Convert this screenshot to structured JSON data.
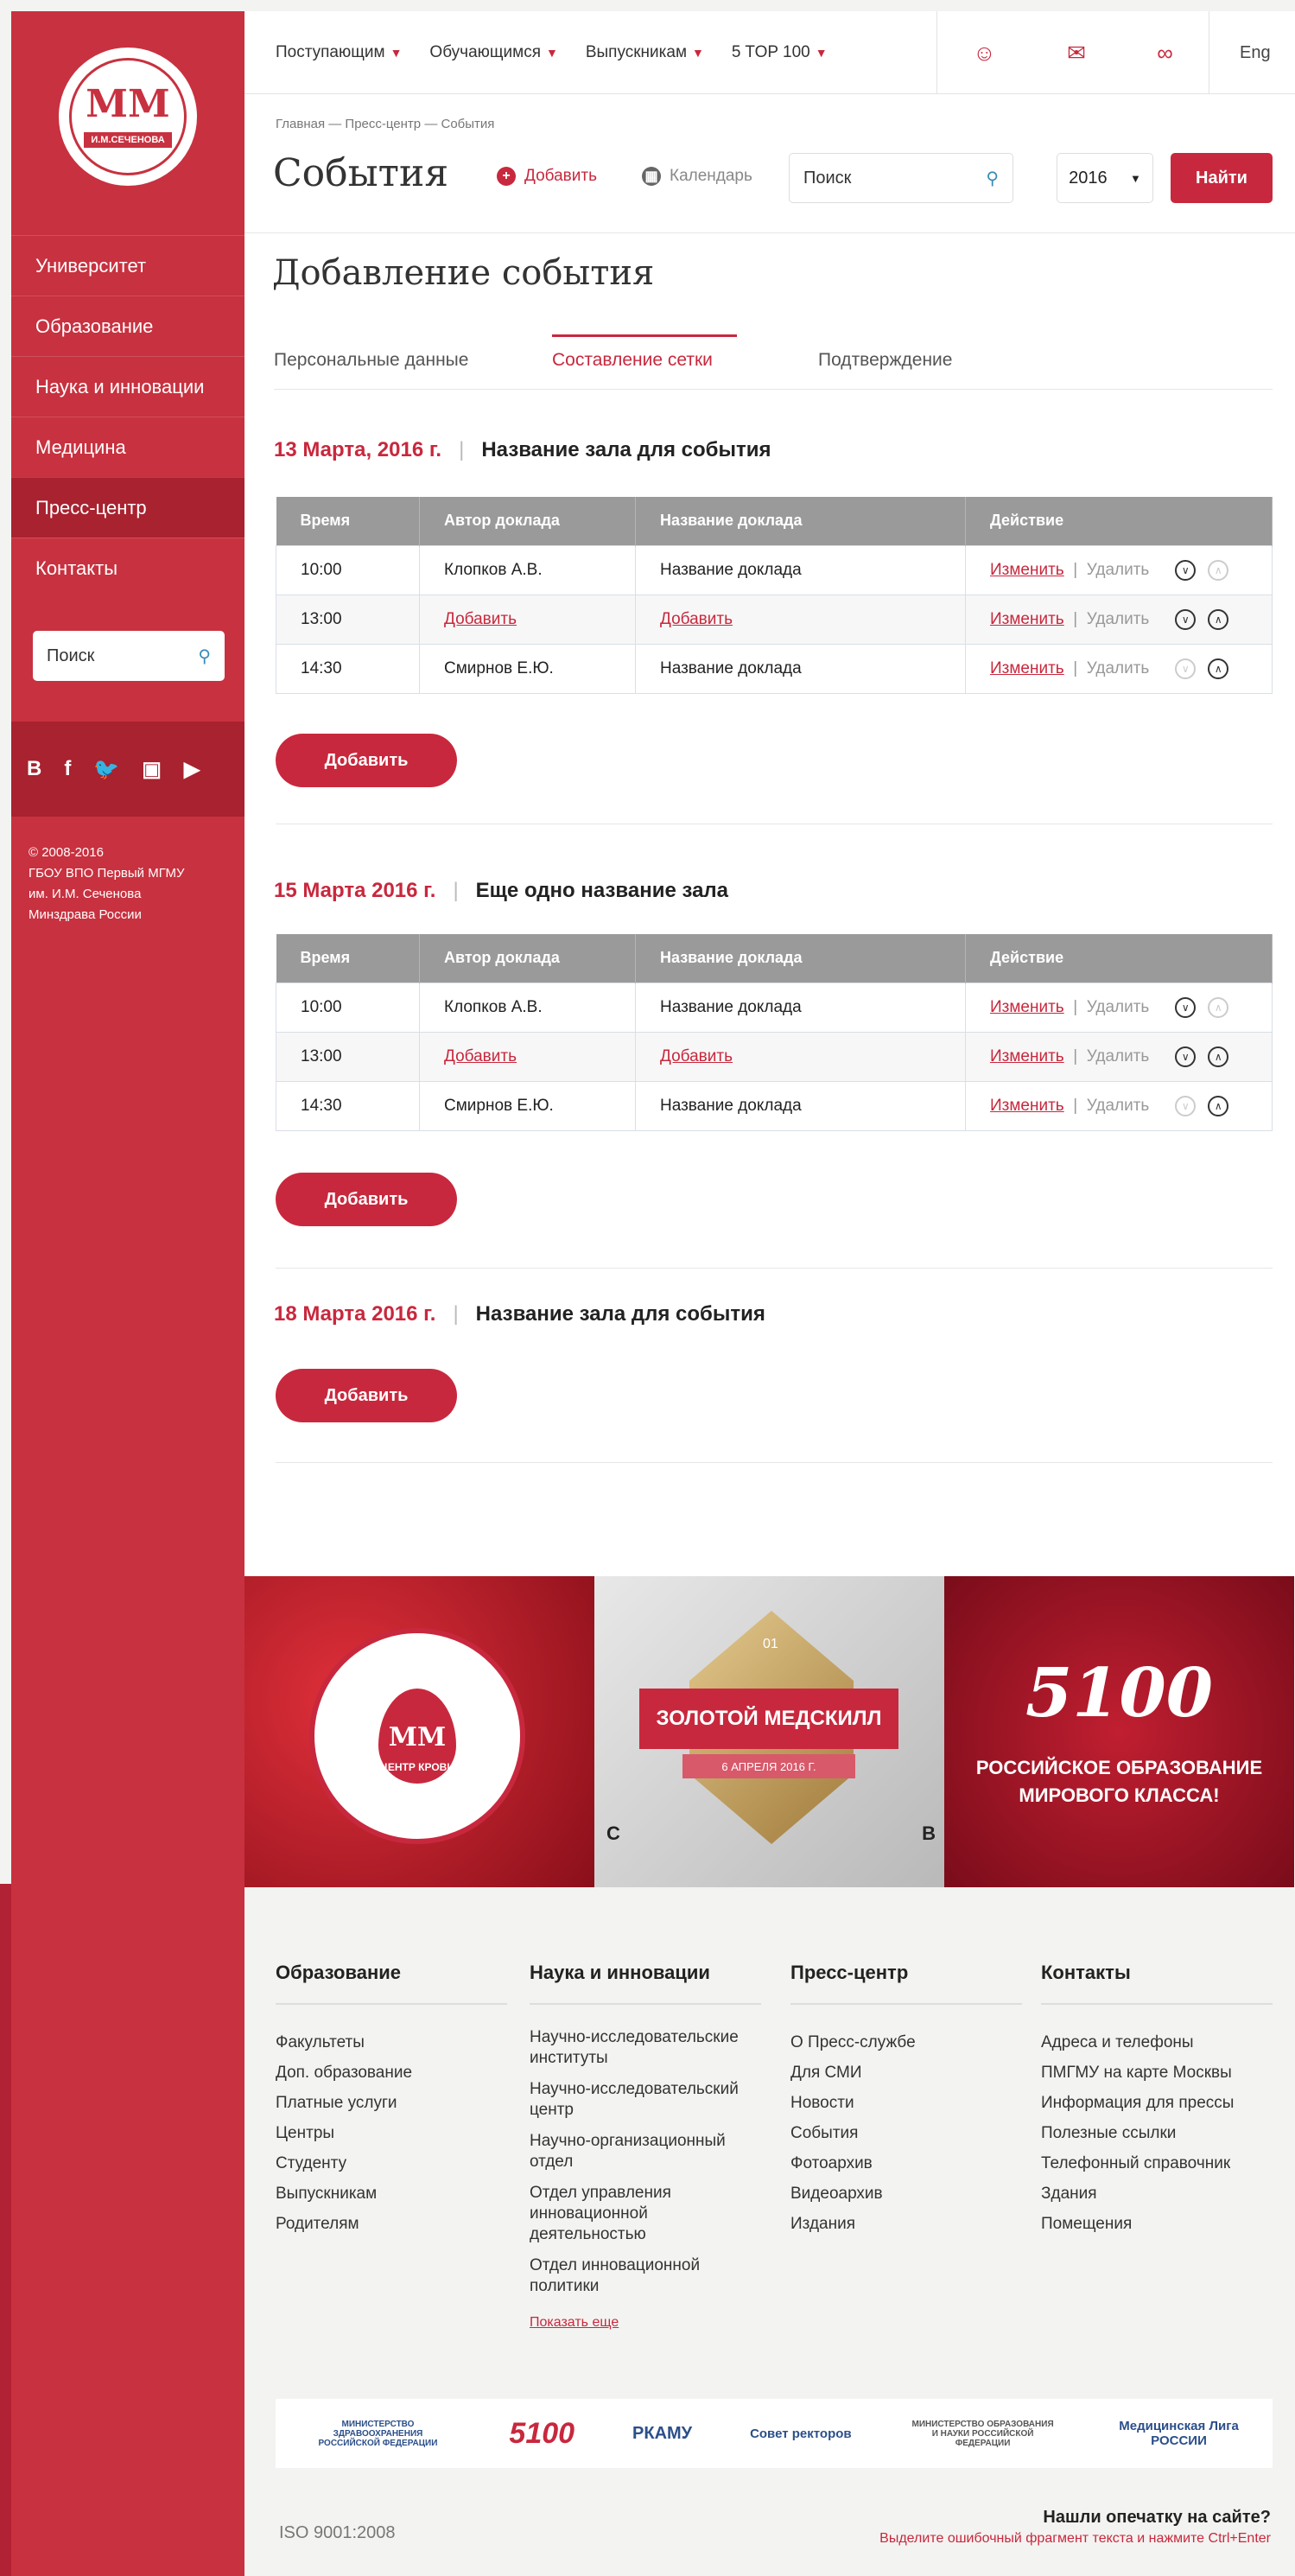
{
  "sidebar": {
    "logo_mark": "ММ",
    "logo_text": "И.М.СЕЧЕНОВА",
    "items": [
      {
        "label": "Университет"
      },
      {
        "label": "Образование"
      },
      {
        "label": "Наука и инновации"
      },
      {
        "label": "Медицина"
      },
      {
        "label": "Пресс-центр",
        "active": true
      },
      {
        "label": "Контакты"
      }
    ],
    "search_placeholder": "Поиск",
    "social": [
      "B",
      "f",
      "t",
      "ig",
      "yt"
    ],
    "copyright": [
      "© 2008-2016",
      "ГБОУ ВПО Первый МГМУ",
      "им. И.М. Сеченова",
      "Минздрава России"
    ]
  },
  "topbar": {
    "nav": [
      "Поступающим",
      "Обучающимся",
      "Выпускникам",
      "5 TOP 100"
    ],
    "icons": [
      "user-icon",
      "mail-icon",
      "glasses-icon"
    ],
    "lang": "Eng"
  },
  "main": {
    "breadcrumb": "Главная — Пресс-центр — События",
    "title": "События",
    "add_label": "Добавить",
    "calendar_label": "Календарь",
    "search_placeholder": "Поиск",
    "year": "2016",
    "find_label": "Найти",
    "subtitle": "Добавление события",
    "steps": [
      "Персональные данные",
      "Составление сетки",
      "Подтверждение"
    ],
    "table_headers": [
      "Время",
      "Автор доклада",
      "Название доклада",
      "Действие"
    ],
    "edit_label": "Изменить",
    "delete_label": "Удалить",
    "add_button": "Добавить",
    "halls": [
      {
        "date": "13 Марта, 2016 г.",
        "name": "Название зала для события",
        "rows": [
          {
            "time": "10:00",
            "author": "Клопков А.В.",
            "title": "Название доклада"
          },
          {
            "time": "13:00",
            "author": "Добавить",
            "title": "Добавить"
          },
          {
            "time": "14:30",
            "author": "Смирнов Е.Ю.",
            "title": "Название доклада"
          }
        ]
      },
      {
        "date": "15 Марта 2016 г.",
        "name": "Еще одно название зала",
        "rows": [
          {
            "time": "10:00",
            "author": "Клопков А.В.",
            "title": "Название доклада"
          },
          {
            "time": "13:00",
            "author": "Добавить",
            "title": "Добавить"
          },
          {
            "time": "14:30",
            "author": "Смирнов Е.Ю.",
            "title": "Название доклада"
          }
        ]
      },
      {
        "date": "18 Марта 2016 г.",
        "name": "Название зала для события",
        "rows": []
      }
    ]
  },
  "banners": {
    "blood": {
      "mark": "ММ",
      "label": "ЦЕНТР КРОВИ"
    },
    "medskill": {
      "num": "01",
      "title": "ЗОЛОТОЙ МЕДСКИЛЛ",
      "date": "6 АПРЕЛЯ 2016 Г.",
      "left": "C",
      "right": "B"
    },
    "top100": {
      "logo": "5100",
      "text": [
        "РОССИЙСКОЕ ОБРАЗОВАНИЕ",
        "МИРОВОГО КЛАССА!"
      ]
    }
  },
  "footer": {
    "columns": [
      {
        "title": "Образование",
        "items": [
          "Факультеты",
          "Доп. образование",
          "Платные услуги",
          "Центры",
          "Студенту",
          "Выпускникам",
          "Родителям"
        ]
      },
      {
        "title": "Наука и инновации",
        "items": [
          "Научно-исследовательские институты",
          "Научно-исследовательский центр",
          "Научно-организационный отдел",
          "Отдел управления инновационной деятельностью",
          "Отдел инновационной политики"
        ],
        "more": "Показать еще"
      },
      {
        "title": "Пресс-центр",
        "items": [
          "О Пресс-службе",
          "Для СМИ",
          "Новости",
          "События",
          "Фотоархив",
          "Видеоархив",
          "Издания"
        ]
      },
      {
        "title": "Контакты",
        "items": [
          "Адреса и телефоны",
          "ПМГМУ на карте Москвы",
          "Информация для прессы",
          "Полезные ссылки",
          "Телефонный справочник",
          "Здания",
          "Помещения"
        ]
      }
    ],
    "partners": [
      "МИНИСТЕРСТВО ЗДРАВООХРАНЕНИЯ РОССИЙСКОЙ ФЕДЕРАЦИИ",
      "5100",
      "РКАМУ",
      "Совет ректоров",
      "МИНИСТЕРСТВО ОБРАЗОВАНИЯ И НАУКИ РОССИЙСКОЙ ФЕДЕРАЦИИ",
      "Медицинская Лига РОССИИ"
    ],
    "iso": "ISO 9001:2008",
    "typo_question": "Нашли опечатку на сайте?",
    "typo_hint": "Выделите ошибочный фрагмент текста и нажмите Ctrl+Enter"
  }
}
